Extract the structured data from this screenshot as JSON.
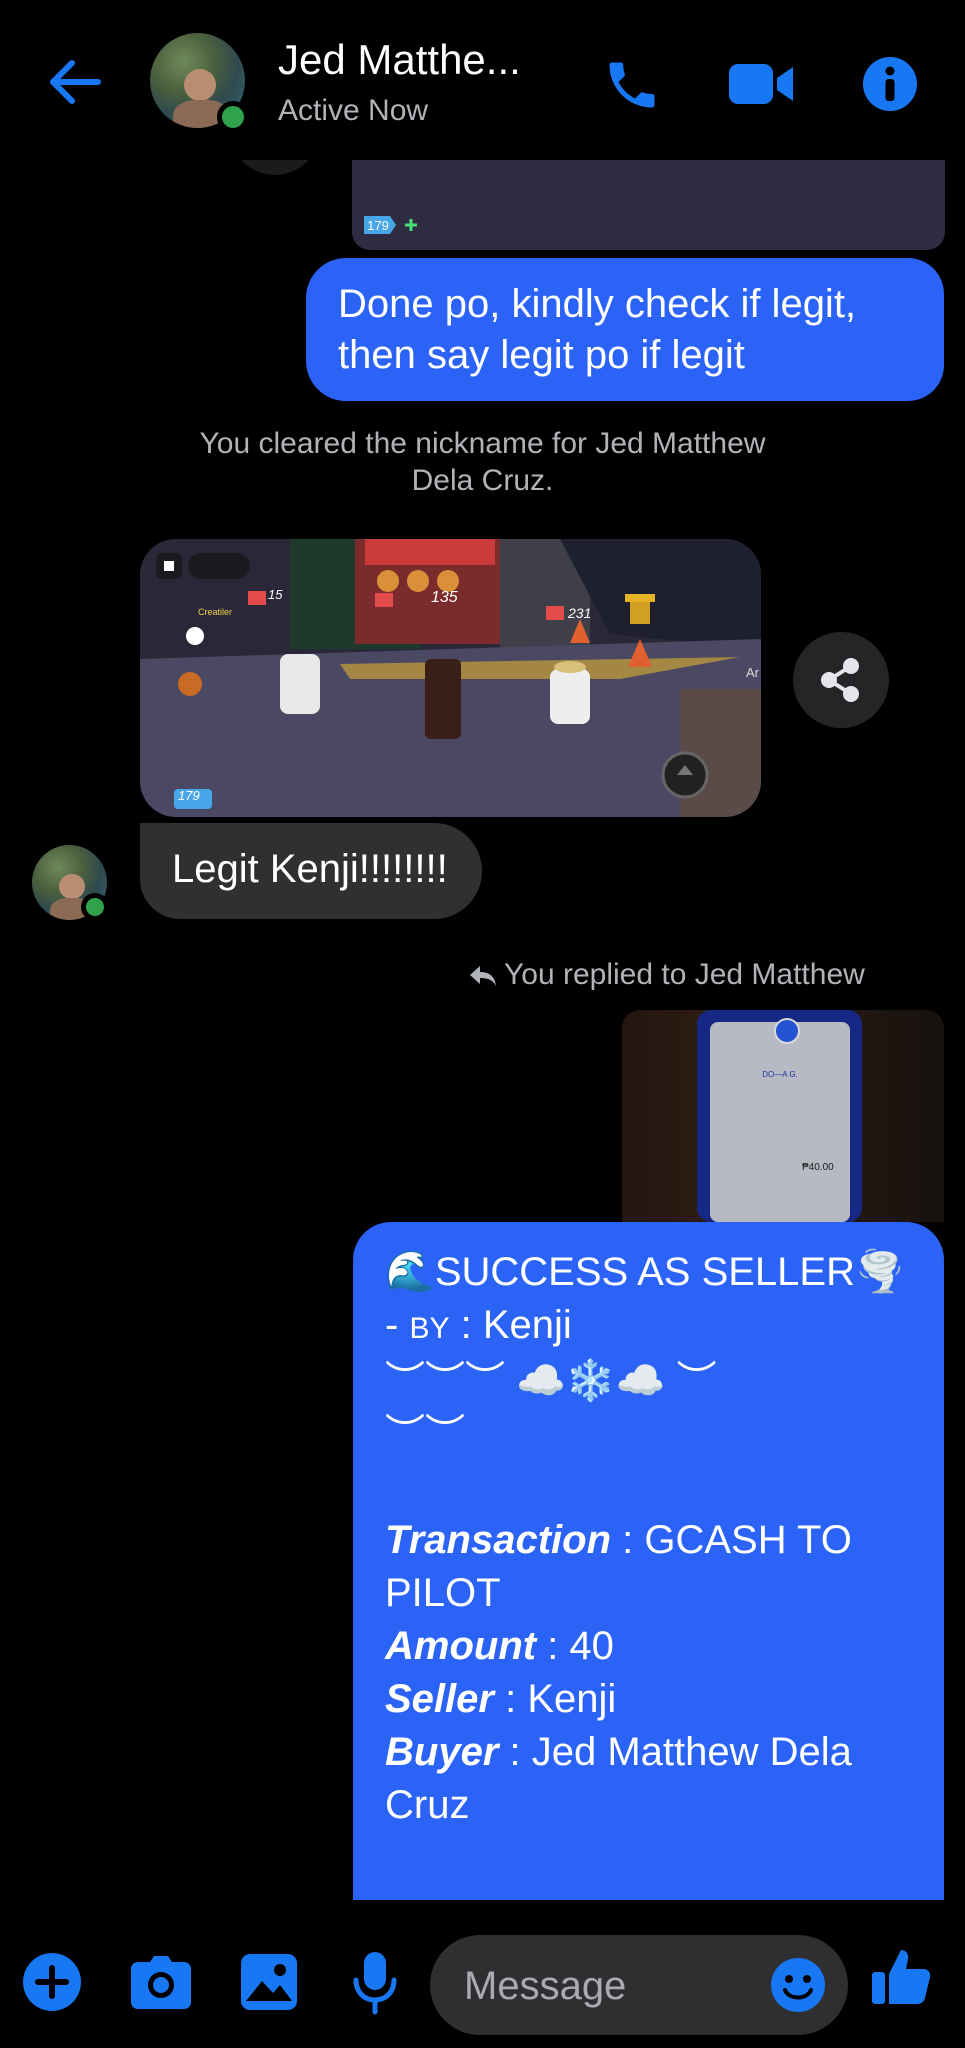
{
  "header": {
    "contact_name": "Jed Matthe...",
    "status": "Active Now",
    "icons": [
      "back-arrow-icon",
      "phone-icon",
      "video-camera-icon",
      "info-icon"
    ]
  },
  "messages": {
    "sent_1": [
      "Done po, kindly check if legit,",
      "then say legit po if legit"
    ],
    "system_1": [
      "You cleared the nickname for Jed Matthew",
      "Dela Cruz."
    ],
    "image_overlay": {
      "top_counter_1": "15",
      "top_counter_2": "135",
      "top_counter_3": "231",
      "creatiler": "Creatiler",
      "badge": "179",
      "side_label": "Ar"
    },
    "received_1": "Legit Kenji!!!!!!!!",
    "reply_indicator": "You replied to Jed Matthew",
    "receipt": {
      "brand": "DO—A G.",
      "amount": "₱40.00"
    },
    "seller_card": {
      "title_icon_left": "🌊",
      "title": "SUCCESS AS SELLER",
      "title_icon_right": "🌪️",
      "by_prefix": "- ",
      "by_label": "BY",
      "by_sep": " : ",
      "by_value": "Kenji",
      "deco_1": "︶︶︶ ☁️❄️☁️ ︶",
      "deco_2": "︶︶",
      "fields": [
        {
          "label": "Transaction",
          "sep": " : ",
          "value": "GCASH TO PILOT"
        },
        {
          "label": "Amount",
          "sep": " : ",
          "value": "40"
        },
        {
          "label": "Seller",
          "sep": " : ",
          "value": "Kenji"
        },
        {
          "label": "Buyer",
          "sep": " : ",
          "value": "Jed Matthew Dela Cruz"
        }
      ]
    }
  },
  "composer": {
    "placeholder": "Message",
    "icons": [
      "plus-icon",
      "camera-icon",
      "gallery-icon",
      "microphone-icon",
      "emoji-icon",
      "like-icon"
    ]
  },
  "colors": {
    "accent": "#2b63f6",
    "icon_blue": "#1877f2",
    "online": "#31a24c",
    "bubble_grey": "#303030"
  }
}
